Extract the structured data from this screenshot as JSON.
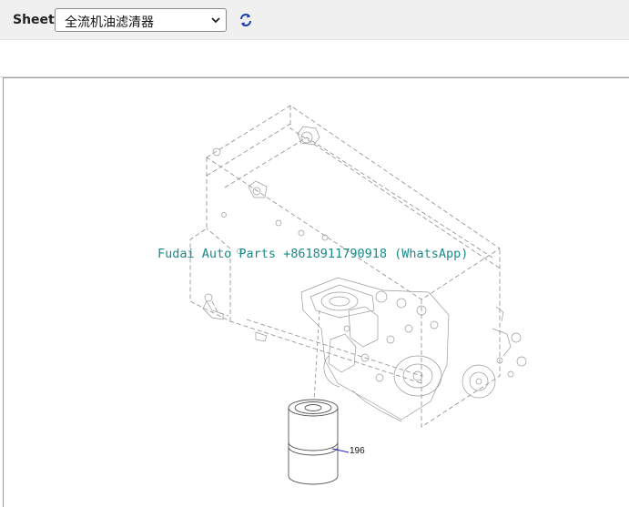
{
  "toolbar": {
    "sheet_label": "Sheet",
    "sheet_select_value": "全流机油滤清器",
    "refresh_icon": "refresh-icon",
    "chevron_icon": "chevron-down-icon"
  },
  "drawing": {
    "watermark": "Fudai Auto Parts +8618911790918 (WhatsApp)",
    "callouts": [
      {
        "number": "196"
      }
    ]
  },
  "colors": {
    "watermark": "#1a8a8a",
    "callout_line": "#1f1fb8",
    "refresh_icon": "#1a3fb0"
  }
}
